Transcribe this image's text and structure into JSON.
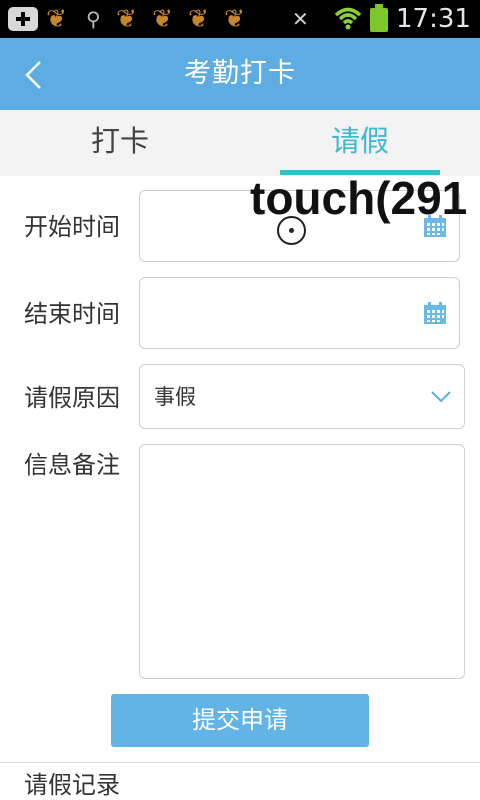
{
  "status_bar": {
    "time": "17:31",
    "notification_icons": [
      "plus-box-icon",
      "squirrel-app-icon",
      "search-icon",
      "squirrel-app-icon",
      "squirrel-app-icon",
      "squirrel-app-icon",
      "squirrel-app-icon"
    ],
    "system_icons": [
      "mute-icon",
      "wifi-icon",
      "battery-icon"
    ],
    "battery_color": "#7cc72a"
  },
  "header": {
    "title": "考勤打卡",
    "back_icon": "chevron-left-icon",
    "background": "#5dade2"
  },
  "tabs": [
    {
      "label": "打卡",
      "active": false
    },
    {
      "label": "请假",
      "active": true
    }
  ],
  "tab_active_color": "#3fb8d0",
  "form": {
    "start_time": {
      "label": "开始时间",
      "value": "",
      "icon": "calendar-icon"
    },
    "end_time": {
      "label": "结束时间",
      "value": "",
      "icon": "calendar-icon"
    },
    "reason": {
      "label": "请假原因",
      "value": "事假",
      "icon": "chevron-down-icon"
    },
    "remarks": {
      "label": "信息备注",
      "value": ""
    }
  },
  "submit_label": "提交申请",
  "records_label": "请假记录",
  "touch_overlay": {
    "text": "touch(291"
  }
}
